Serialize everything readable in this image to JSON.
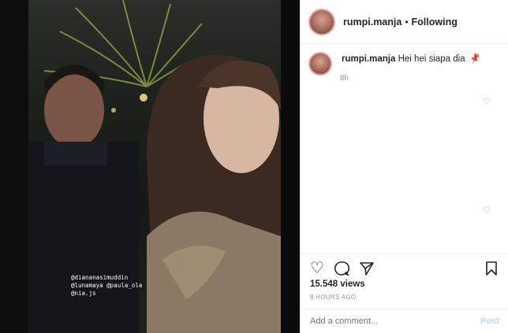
{
  "header": {
    "username": "rumpi.manja",
    "separator": "•",
    "follow_status": "Following"
  },
  "caption": {
    "username": "rumpi.manja",
    "text": "Hei hei siapa dia",
    "emoji_icon": "pushpin-icon",
    "time": "8h"
  },
  "stats": {
    "views": "15.548 views",
    "posted": "8 HOURS AGO"
  },
  "comment_box": {
    "placeholder": "Add a comment...",
    "post_label": "Post"
  },
  "media_tags": {
    "tag1": "@diananasimuddin",
    "tag2": "@lunamaya",
    "tag3": "@paula_ola",
    "tag4": "@nia.js"
  },
  "colors": {
    "accent_link": "#b3dbff",
    "text_primary": "#262626",
    "text_muted": "#999999"
  }
}
